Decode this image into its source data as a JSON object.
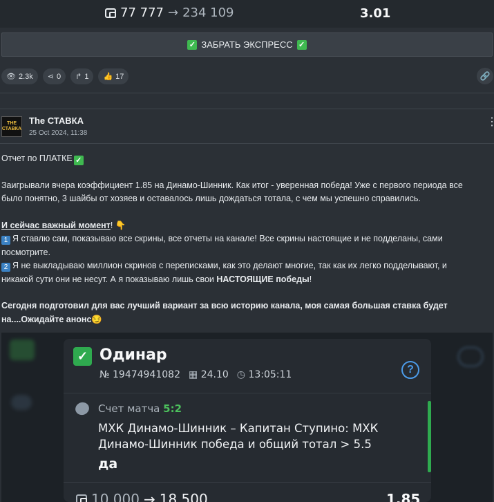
{
  "top_bet": {
    "stake": "77 777",
    "arrow": "→",
    "payout": "234 109",
    "coef": "3.01"
  },
  "claim_button": {
    "label": "ЗАБРАТЬ ЭКСПРЕСС",
    "icon": "check-emoji",
    "icon_glyph": "✓"
  },
  "reactions": [
    {
      "icon": "eye-icon",
      "glyph": "👁",
      "count": "2.3k"
    },
    {
      "icon": "share-icon",
      "glyph": "⋖",
      "count": "0"
    },
    {
      "icon": "forward-icon",
      "glyph": "↱",
      "count": "1"
    },
    {
      "icon": "thumbs-up-icon",
      "glyph": "👍",
      "count": "17"
    }
  ],
  "link_icon_glyph": "🔗",
  "post": {
    "avatar_text": [
      "THE",
      "СТАВКА"
    ],
    "author": "The СТАВКА",
    "date": "25 Oct 2024, 11:38",
    "kebab": "⋮",
    "line1_text": "Отчет по ПЛАТКЕ",
    "line1_emoji": "✓",
    "para1": "Заигрывали вчера коэффициент 1.85 на Динамо-Шинник. Как итог - уверенная победа! Уже с первого периода все было понятно, 3 шайбы от хозяев и оставалось лишь дождаться тотала, с чем мы успешно справились.",
    "important": "И сейчас важный момент",
    "important_tail": "! ",
    "important_emoji": "👇",
    "item1_num": "1",
    "item1": "Я ставлю сам, показываю все скрины, все отчеты на канале! Все скрины настоящие и не подделаны, сами посмотрите.",
    "item2_num": "2",
    "item2_a": "Я не выкладываю миллион скринов с переписками, как это делают многие, так как их легко подделывают, и никакой сути они не несут. А я показываю лишь свои ",
    "item2_bold": "НАСТОЯЩИЕ победы",
    "item2_b": "!",
    "closing": "Сегодня подготовил для вас лучший вариант за всю историю канала, моя самая большая ставка будет на....Ожидайте анонс",
    "closing_emoji": "😏"
  },
  "bet_slip": {
    "check": "✓",
    "title": "Одинар",
    "number": "№ 19474941082",
    "date_icon": "calendar-icon",
    "date_glyph": "▦",
    "date": "24.10",
    "time_icon": "clock-icon",
    "time_glyph": "◷",
    "time": "13:05:11",
    "help": "?",
    "score_label": "Счет матча",
    "score": "5:2",
    "event": "МХК Динамо-Шинник – Капитан Ступино: МХК Динамо-Шинник победа и общий тотал > 5.5",
    "outcome": "да",
    "stake": "10 000",
    "arrow": "→",
    "payout": "18 500",
    "coef": "1.85"
  },
  "colors": {
    "background": "#2b3036",
    "accent_green": "#2faa4f",
    "accent_blue": "#4c9be8"
  }
}
